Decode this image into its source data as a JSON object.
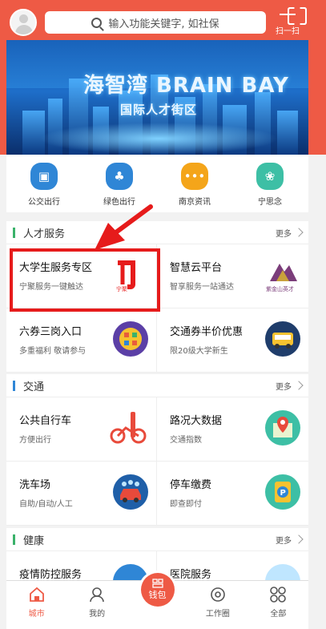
{
  "theme": {
    "accent": "#ee5a45",
    "highlight": "#e61b1b"
  },
  "topbar": {
    "search_placeholder": "输入功能关键字, 如社保",
    "scan_label": "扫一扫"
  },
  "banner": {
    "title": "海智湾 BRAIN BAY",
    "subtitle": "国际人才街区"
  },
  "quick_links": [
    {
      "label": "公交出行",
      "icon": "bus-icon",
      "color": "#2f86d6"
    },
    {
      "label": "绿色出行",
      "icon": "tree-icon",
      "color": "#2f86d6"
    },
    {
      "label": "南京资讯",
      "icon": "chat-bubble-icon",
      "color": "#f4a51a"
    },
    {
      "label": "宁思念",
      "icon": "flower-icon",
      "color": "#3dbfa5"
    }
  ],
  "sections": {
    "talent": {
      "title": "人才服务",
      "bar_color": "#3ab26a",
      "more": "更多",
      "items": [
        {
          "title": "大学生服务专区",
          "sub": "宁聚服务一键触达",
          "icon": "ningju-logo-icon",
          "icon_text": "宁聚"
        },
        {
          "title": "智慧云平台",
          "sub": "智享服务一站通达",
          "icon": "zijinshan-logo-icon",
          "icon_text": "紫金山英才"
        },
        {
          "title": "六券三岗入口",
          "sub": "多重福利 敬请参与",
          "icon": "coupons-icon"
        },
        {
          "title": "交通券半价优惠",
          "sub": "限20级大学新生",
          "icon": "bus-ticket-icon"
        }
      ]
    },
    "traffic": {
      "title": "交通",
      "bar_color": "#2f86d6",
      "more": "更多",
      "items": [
        {
          "title": "公共自行车",
          "sub": "方便出行",
          "icon": "bicycle-icon"
        },
        {
          "title": "路况大数据",
          "sub": "交通指数",
          "icon": "map-pin-icon"
        },
        {
          "title": "洗车场",
          "sub": "自助/自动/人工",
          "icon": "car-wash-icon"
        },
        {
          "title": "停车缴费",
          "sub": "即查即付",
          "icon": "parking-icon"
        }
      ]
    },
    "health": {
      "title": "健康",
      "bar_color": "#3ab26a",
      "more": "更多",
      "items": [
        {
          "title": "疫情防控服务",
          "icon": "building-icon"
        },
        {
          "title": "医院服务",
          "icon": "doctor-icon"
        }
      ]
    }
  },
  "bottom_nav": [
    {
      "label": "城市",
      "icon": "home-icon",
      "active": true
    },
    {
      "label": "我的",
      "icon": "user-icon"
    },
    {
      "label": "钱包",
      "icon": "wallet-icon"
    },
    {
      "label": "工作圈",
      "icon": "circle-icon"
    },
    {
      "label": "全部",
      "icon": "grid-icon"
    }
  ]
}
